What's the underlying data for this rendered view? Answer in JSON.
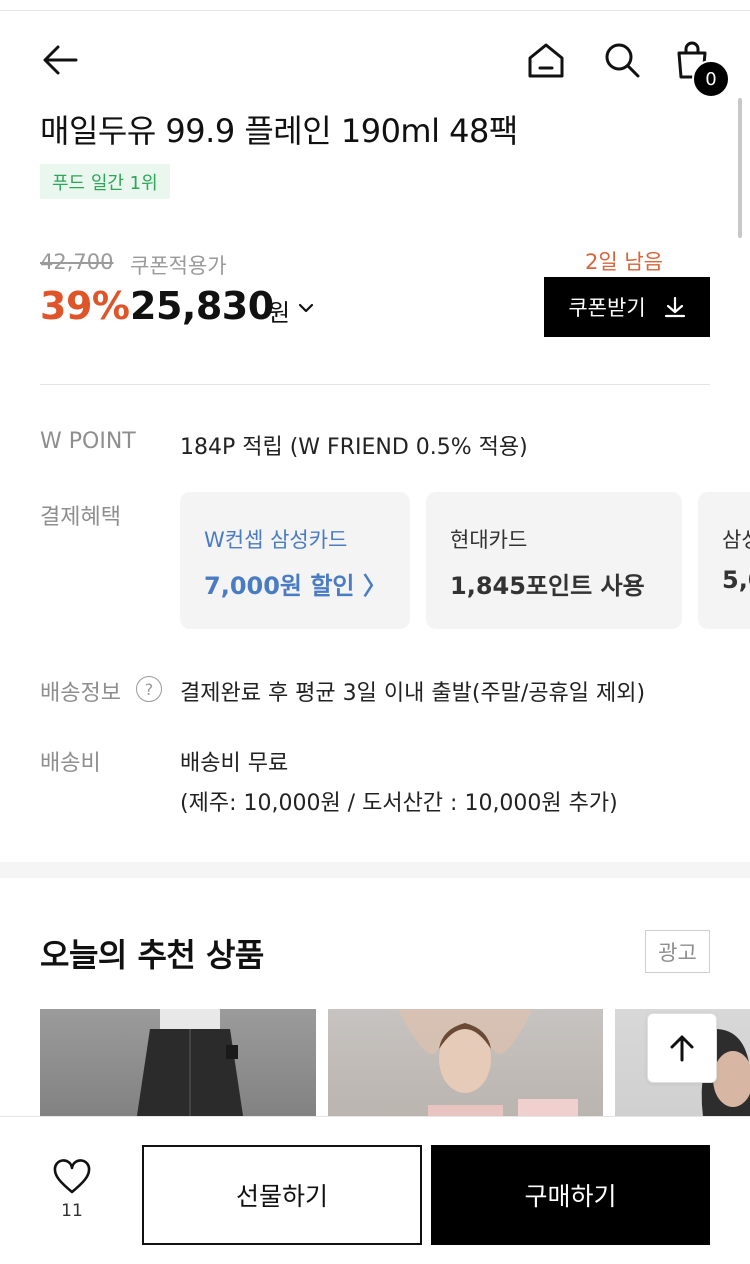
{
  "header": {
    "cart_count": "0"
  },
  "product": {
    "title": "매일두유 99.9 플레인 190ml 48팩",
    "rank_badge": "푸드 일간 1위",
    "original_price": "42,700",
    "coupon_price_label": "쿠폰적용가",
    "discount_rate": "39%",
    "sale_price": "25,830",
    "price_unit": "원"
  },
  "coupon": {
    "days_left": "2일 남음",
    "button_label": "쿠폰받기"
  },
  "points": {
    "label": "W POINT",
    "value": "184P 적립 (W FRIEND 0.5% 적용)"
  },
  "payment_benefits": {
    "label": "결제혜택",
    "cards": [
      {
        "name": "W컨셉 삼성카드",
        "benefit": "7,000원 할인 〉"
      },
      {
        "name": "현대카드",
        "benefit": "1,845포인트 사용"
      },
      {
        "name": "삼성",
        "benefit": "5,0"
      }
    ]
  },
  "shipping_info": {
    "label": "배송정보",
    "help_glyph": "?",
    "value": "결제완료 후 평균 3일 이내 출발(주말/공휴일 제외)"
  },
  "shipping_fee": {
    "label": "배송비",
    "line1": "배송비 무료",
    "line2": "(제주: 10,000원 / 도서산간 : 10,000원 추가)"
  },
  "recommendations": {
    "title": "오늘의 추천 상품",
    "ad_label": "광고"
  },
  "bottom_bar": {
    "like_count": "11",
    "gift_label": "선물하기",
    "buy_label": "구매하기"
  },
  "colors": {
    "discount": "#e0542a",
    "days_left": "#d9643a",
    "badge_text": "#2da657",
    "badge_bg": "#eaf7ee",
    "card_accent": "#4a7cc4"
  },
  "icons": {
    "back": "back-arrow-icon",
    "home": "home-icon",
    "search": "search-icon",
    "cart": "shopping-bag-icon",
    "download": "download-icon",
    "heart": "heart-icon",
    "scroll_top": "arrow-up-icon",
    "chevron": "chevron-down-icon"
  }
}
